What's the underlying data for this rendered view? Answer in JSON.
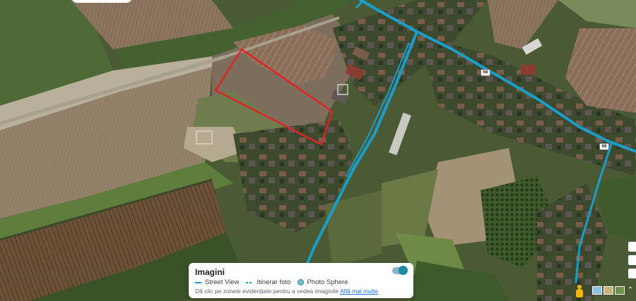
{
  "map": {
    "type": "satellite",
    "highlight_color": "#e02424",
    "street_view_color": "#1a9ec9",
    "road_badge": "68",
    "road_badge_2": "68"
  },
  "legend": {
    "title": "Imagini",
    "items": [
      {
        "label": "Street View",
        "icon": "line"
      },
      {
        "label": "Itinerar foto",
        "icon": "dashed-line"
      },
      {
        "label": "Photo Sphere",
        "icon": "circle"
      }
    ],
    "hint": "Dă clic pe zonele evidențiate pentru a vedea imaginile",
    "hint_link": "Află mai multe",
    "toggle_state": "on"
  },
  "controls": {
    "pegman": "pegman-icon",
    "layers": "layers-thumbnails",
    "expand": "expand-icon"
  }
}
